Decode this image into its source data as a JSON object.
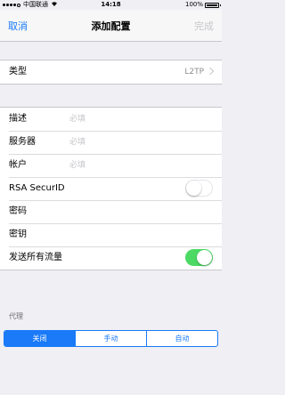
{
  "status_bar": {
    "carrier": "中国联通",
    "time": "14:18",
    "battery": "100%"
  },
  "nav": {
    "cancel": "取消",
    "title": "添加配置",
    "done": "完成"
  },
  "type_row": {
    "label": "类型",
    "value": "L2TP"
  },
  "fields": {
    "description": {
      "label": "描述",
      "placeholder": "必填"
    },
    "server": {
      "label": "服务器",
      "placeholder": "必填"
    },
    "account": {
      "label": "帐户",
      "placeholder": "必填"
    },
    "rsa": {
      "label": "RSA SecurID",
      "on": false
    },
    "password": {
      "label": "密码"
    },
    "secret": {
      "label": "密钥"
    },
    "send_all": {
      "label": "发送所有流量",
      "on": true
    }
  },
  "proxy": {
    "header": "代理",
    "options": [
      "关闭",
      "手动",
      "自动"
    ],
    "selected": "关闭"
  },
  "colors": {
    "accent": "#1a7af8",
    "toggle_on": "#4cd964",
    "background": "#efeff4"
  }
}
